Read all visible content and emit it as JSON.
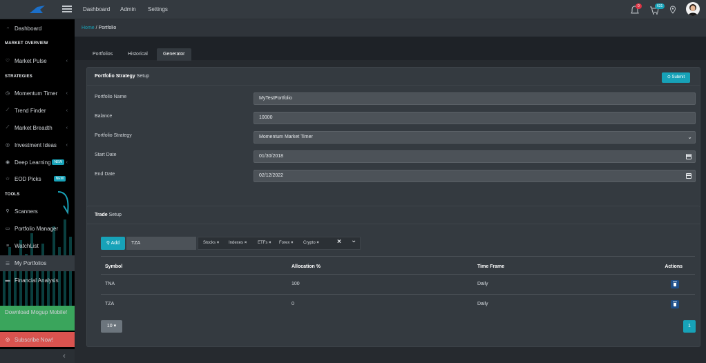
{
  "topbar": {
    "nav": [
      "Dashboard",
      "Admin",
      "Settings"
    ],
    "notification_count": "0",
    "message_count": "631"
  },
  "sidebar": {
    "dashboard": "Dashboard",
    "section_market": "MARKET OVERVIEW",
    "market_pulse": "Market Pulse",
    "section_strategies": "STRATEGIES",
    "momentum_timer": "Momentum Timer",
    "trend_finder": "Trend Finder",
    "market_breadth": "Market Breadth",
    "investment_ideas": "Investment Ideas",
    "deep_learning": "Deep Learning",
    "eod_picks": "EOD Picks",
    "new_badge": "NEW",
    "section_tools": "TOOLS",
    "scanners": "Scanners",
    "portfolio_manager": "Portfolio Manager",
    "watchlist": "WatchList",
    "my_portfolios": "My Portfolios",
    "financial_analysis": "Financial Analysis",
    "download": "Download Mogup Mobile!",
    "subscribe": "Subscribe Now!",
    "collapse": "‹"
  },
  "breadcrumb": {
    "home": "Home",
    "separator": " / ",
    "current": "Portfolio"
  },
  "tabs": [
    "Portfolios",
    "Historical",
    "Generator"
  ],
  "strategy_setup": {
    "title_bold": "Portfolio Strategy",
    "title_rest": " Setup",
    "submit": "⊙ Submit",
    "fields": [
      {
        "label": "Portfolio Name",
        "value": "MyTestPortfolio"
      },
      {
        "label": "Balance",
        "value": "10000"
      },
      {
        "label": "Portfolio Strategy",
        "value": "Momentum Market Timer"
      },
      {
        "label": "Start Date",
        "value": "01/30/2018"
      },
      {
        "label": "End Date",
        "value": "02/12/2022"
      }
    ]
  },
  "trade_setup": {
    "title_bold": "Trade",
    "title_rest": " Setup",
    "add_button": "Add",
    "symbol_input": "TZA",
    "filters": [
      "Stocks",
      "Indexes",
      "ETFs",
      "Forex",
      "Crypto"
    ],
    "columns": [
      "Symbol",
      "Allocation %",
      "Time Frame",
      "Actions"
    ],
    "rows": [
      {
        "symbol": "TNA",
        "allocation": "100",
        "timeframe": "Daily"
      },
      {
        "symbol": "TZA",
        "allocation": "0",
        "timeframe": "Daily"
      }
    ],
    "page_size": "10",
    "page": "1"
  },
  "colors": {
    "accent": "#17a2b8",
    "download": "#3aa55c",
    "subscribe": "#d9534f",
    "active_tab": "#343a40"
  }
}
